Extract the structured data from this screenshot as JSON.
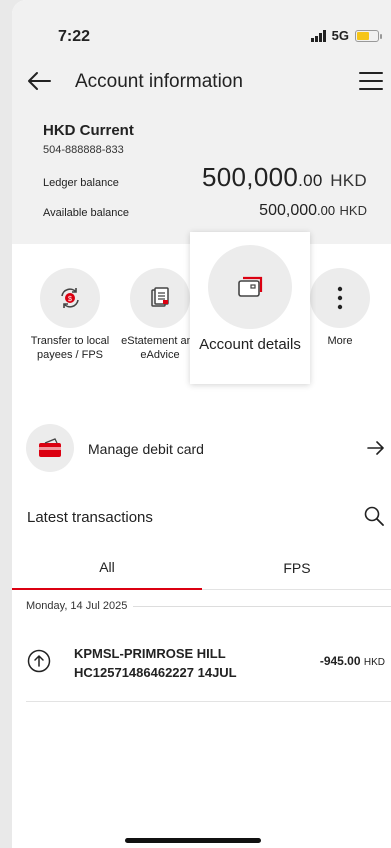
{
  "status_bar": {
    "time": "7:22",
    "network": "5G"
  },
  "header": {
    "title": "Account information"
  },
  "account": {
    "name": "HKD Current",
    "number": "504-888888-833",
    "ledger_label": "Ledger balance",
    "ledger_int": "500,000",
    "ledger_dec": ".00",
    "ledger_currency": "HKD",
    "available_label": "Available balance",
    "available_int": "500,000",
    "available_dec": ".00",
    "available_currency": "HKD"
  },
  "quick_actions": {
    "transfer_label": "Transfer to local payees / FPS",
    "estatement_label": "eStatement and eAdvice",
    "account_details_label": "Account details",
    "more_label": "More"
  },
  "debit_card": {
    "label": "Manage debit card"
  },
  "transactions": {
    "title": "Latest transactions",
    "tabs": [
      {
        "label": "All",
        "active": true
      },
      {
        "label": "FPS",
        "active": false
      }
    ],
    "groups": [
      {
        "date": "Monday, 14 Jul 2025",
        "items": [
          {
            "description_line1": "KPMSL-PRIMROSE HILL",
            "description_line2": "HC12571486462227 14JUL",
            "amount": "-945.00",
            "currency": "HKD"
          }
        ]
      }
    ]
  },
  "colors": {
    "accent": "#db0011",
    "battery": "#f5c518",
    "panel": "#f1f1f1"
  }
}
